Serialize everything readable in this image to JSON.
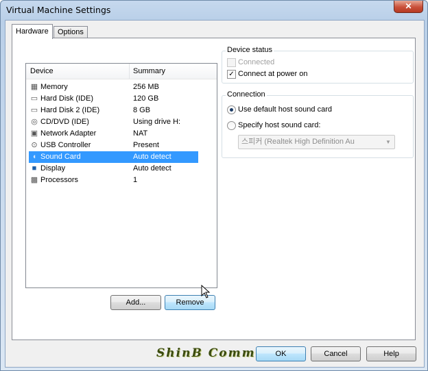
{
  "window": {
    "title": "Virtual Machine Settings",
    "close_glyph": "✕"
  },
  "tabs": [
    {
      "label": "Hardware"
    },
    {
      "label": "Options"
    }
  ],
  "device_list": {
    "columns": {
      "device": "Device",
      "summary": "Summary"
    },
    "rows": [
      {
        "icon": "memory-icon",
        "device": "Memory",
        "summary": "256 MB"
      },
      {
        "icon": "hard-disk-icon",
        "device": "Hard Disk (IDE)",
        "summary": "120 GB"
      },
      {
        "icon": "hard-disk-icon",
        "device": "Hard Disk 2 (IDE)",
        "summary": "8 GB"
      },
      {
        "icon": "cd-dvd-icon",
        "device": "CD/DVD (IDE)",
        "summary": "Using drive H:"
      },
      {
        "icon": "network-adapter-icon",
        "device": "Network Adapter",
        "summary": "NAT"
      },
      {
        "icon": "usb-icon",
        "device": "USB Controller",
        "summary": "Present"
      },
      {
        "icon": "sound-card-icon",
        "device": "Sound Card",
        "summary": "Auto detect"
      },
      {
        "icon": "display-icon",
        "device": "Display",
        "summary": "Auto detect"
      },
      {
        "icon": "processor-icon",
        "device": "Processors",
        "summary": "1"
      }
    ],
    "selected": "Sound Card"
  },
  "buttons": {
    "add": "Add...",
    "remove": "Remove",
    "ok": "OK",
    "cancel": "Cancel",
    "help": "Help"
  },
  "device_status": {
    "legend": "Device status",
    "connected": {
      "label": "Connected",
      "checked": false,
      "enabled": false
    },
    "connect_at_power_on": {
      "label": "Connect at power on",
      "checked": true,
      "check_glyph": "✓"
    }
  },
  "connection": {
    "legend": "Connection",
    "use_default": {
      "label": "Use default host sound card",
      "selected": true
    },
    "specify": {
      "label": "Specify host sound card:",
      "selected": false
    },
    "host_card_select": {
      "value": "스피커 (Realtek High Definition Au",
      "arrow": "▼",
      "enabled": false
    }
  },
  "watermark": "ShinB  Community"
}
